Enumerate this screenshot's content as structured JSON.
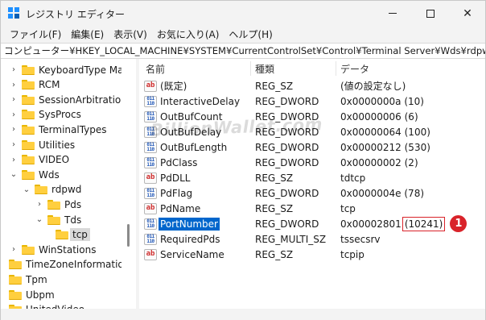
{
  "titlebar": {
    "title": "レジストリ エディター",
    "minimize_icon": "minimize-icon",
    "maximize_icon": "maximize-icon",
    "close_icon": "close-icon",
    "close_glyph": "✕"
  },
  "menu": [
    "ファイル(F)",
    "編集(E)",
    "表示(V)",
    "お気に入り(A)",
    "ヘルプ(H)"
  ],
  "address": "コンピューター¥HKEY_LOCAL_MACHINE¥SYSTEM¥CurrentControlSet¥Control¥Terminal Server¥Wds¥rdpwd¥Tds¥tcp",
  "tree": [
    {
      "label": "KeyboardType Mapping",
      "chevron": "›",
      "expanded": false
    },
    {
      "label": "RCM",
      "chevron": "›",
      "expanded": false
    },
    {
      "label": "SessionArbitrationHelper",
      "chevron": "›",
      "expanded": false
    },
    {
      "label": "SysProcs",
      "chevron": "›",
      "expanded": false
    },
    {
      "label": "TerminalTypes",
      "chevron": "›",
      "expanded": false
    },
    {
      "label": "Utilities",
      "chevron": "›",
      "expanded": false
    },
    {
      "label": "VIDEO",
      "chevron": "›",
      "expanded": false
    },
    {
      "label": "Wds",
      "chevron": "⌄",
      "expanded": true
    },
    {
      "label": "rdpwd",
      "chevron": "⌄",
      "expanded": true
    },
    {
      "label": "Pds",
      "chevron": "›",
      "expanded": false
    },
    {
      "label": "Tds",
      "chevron": "⌄",
      "expanded": true
    },
    {
      "label": "tcp",
      "chevron": "",
      "expanded": false,
      "selected": true
    },
    {
      "label": "WinStations",
      "chevron": "›",
      "expanded": false
    },
    {
      "label": "TimeZoneInformation",
      "chevron": "",
      "expanded": false
    },
    {
      "label": "Tpm",
      "chevron": "",
      "expanded": false
    },
    {
      "label": "Ubpm",
      "chevron": "",
      "expanded": false
    },
    {
      "label": "UnitedVideo",
      "chevron": "",
      "expanded": false
    }
  ],
  "columns": {
    "name": "名前",
    "type": "種類",
    "data": "データ"
  },
  "values": [
    {
      "icon": "ab",
      "name": "(既定)",
      "type": "REG_SZ",
      "data": "(値の設定なし)"
    },
    {
      "icon": "bin",
      "name": "InteractiveDelay",
      "type": "REG_DWORD",
      "data": "0x0000000a (10)"
    },
    {
      "icon": "bin",
      "name": "OutBufCount",
      "type": "REG_DWORD",
      "data": "0x00000006 (6)"
    },
    {
      "icon": "bin",
      "name": "OutBufDelay",
      "type": "REG_DWORD",
      "data": "0x00000064 (100)"
    },
    {
      "icon": "bin",
      "name": "OutBufLength",
      "type": "REG_DWORD",
      "data": "0x00000212 (530)"
    },
    {
      "icon": "bin",
      "name": "PdClass",
      "type": "REG_DWORD",
      "data": "0x00000002 (2)"
    },
    {
      "icon": "ab",
      "name": "PdDLL",
      "type": "REG_SZ",
      "data": "tdtcp"
    },
    {
      "icon": "bin",
      "name": "PdFlag",
      "type": "REG_DWORD",
      "data": "0x0000004e (78)"
    },
    {
      "icon": "ab",
      "name": "PdName",
      "type": "REG_SZ",
      "data": "tcp"
    },
    {
      "icon": "bin",
      "name": "PortNumber",
      "type": "REG_DWORD",
      "data": "0x00002801",
      "data_highlight": "(10241)",
      "badge": "1",
      "highlight": true
    },
    {
      "icon": "bin",
      "name": "RequiredPds",
      "type": "REG_MULTI_SZ",
      "data": "tssecsrv"
    },
    {
      "icon": "ab",
      "name": "ServiceName",
      "type": "REG_SZ",
      "data": "tcpip"
    }
  ],
  "icon_glyphs": {
    "ab": "ab",
    "bin": "011\n110"
  },
  "watermark": "BillionWallet.com",
  "colors": {
    "selection": "#0066cc",
    "annotation": "#d9232a",
    "folder": "#ffcf3f"
  }
}
